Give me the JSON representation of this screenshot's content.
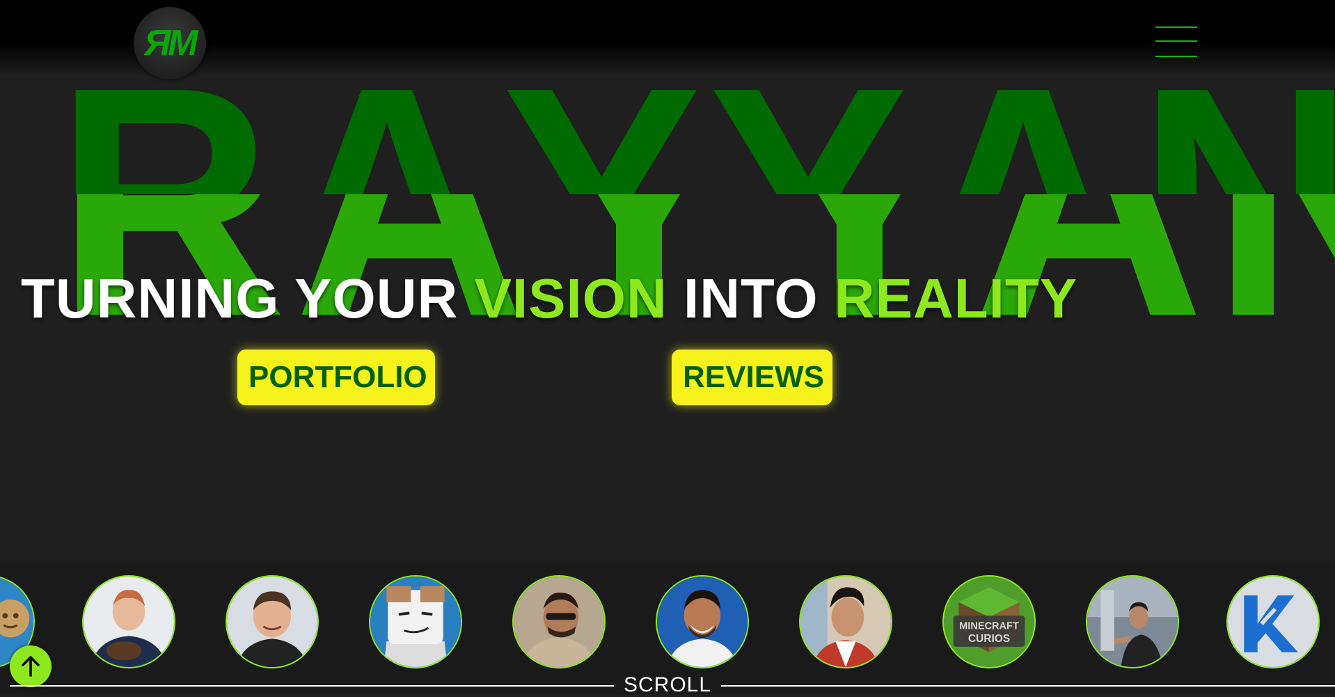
{
  "brand": {
    "logo_text": "ЯM"
  },
  "hero": {
    "background_word": "RAYYAN",
    "headline": {
      "part1": "TURNING YOUR ",
      "part2": "VISION",
      "part3": " INTO ",
      "part4": "REALITY"
    },
    "buttons": {
      "portfolio": "PORTFOLIO",
      "reviews": "REVIEWS"
    }
  },
  "clients": {
    "avatars": [
      {
        "icon": "client-avatar-1"
      },
      {
        "icon": "client-avatar-2"
      },
      {
        "icon": "client-avatar-3"
      },
      {
        "icon": "client-avatar-4"
      },
      {
        "icon": "client-avatar-5"
      },
      {
        "icon": "client-avatar-6"
      },
      {
        "icon": "client-avatar-7"
      },
      {
        "icon": "client-avatar-8",
        "label": "MINECRAFT CURIOS"
      },
      {
        "icon": "client-avatar-9"
      },
      {
        "icon": "client-avatar-10"
      }
    ]
  },
  "scroll": {
    "label": "SCROLL"
  },
  "colors": {
    "accent_green": "#8ee81e",
    "dark_green": "#006b00",
    "mid_green": "#2aa80a",
    "button_yellow": "#f5f21c",
    "button_text": "#036003",
    "background": "#1f1f1f"
  }
}
